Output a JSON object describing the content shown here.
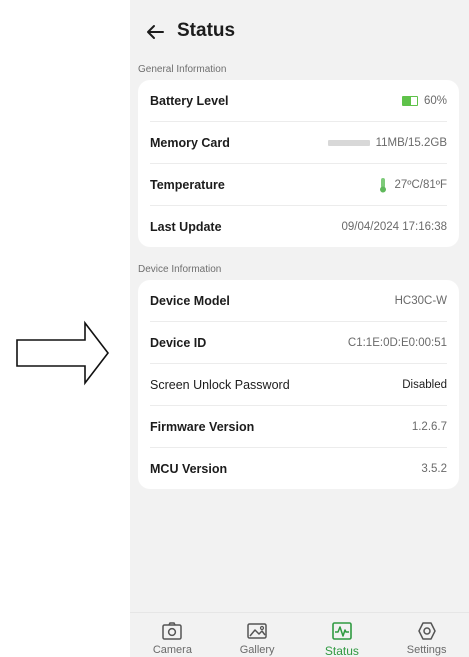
{
  "header": {
    "title": "Status"
  },
  "general": {
    "label": "General Information",
    "rows": [
      {
        "label": "Battery Level",
        "value": "60%",
        "battery_level": 0.6
      },
      {
        "label": "Memory Card",
        "value": "11MB/15.2GB"
      },
      {
        "label": "Temperature",
        "value": "27ºC/81ºF"
      },
      {
        "label": "Last Update",
        "value": "09/04/2024 17:16:38"
      }
    ]
  },
  "device": {
    "label": "Device Information",
    "rows": [
      {
        "label": "Device Model",
        "value": "HC30C-W"
      },
      {
        "label": "Device ID",
        "value": "C1:1E:0D:E0:00:51"
      },
      {
        "label": "Screen Unlock Password",
        "value": "Disabled"
      },
      {
        "label": "Firmware Version",
        "value": "1.2.6.7"
      },
      {
        "label": "MCU Version",
        "value": "3.5.2"
      }
    ]
  },
  "nav": {
    "items": [
      {
        "label": "Camera",
        "icon": "camera-icon"
      },
      {
        "label": "Gallery",
        "icon": "gallery-icon"
      },
      {
        "label": "Status",
        "icon": "status-icon"
      },
      {
        "label": "Settings",
        "icon": "settings-icon"
      }
    ],
    "active": "Status"
  },
  "colors": {
    "accent": "#2f9a41",
    "battery": "#5fc24a",
    "background": "#f2f2f2",
    "card": "#ffffff"
  }
}
